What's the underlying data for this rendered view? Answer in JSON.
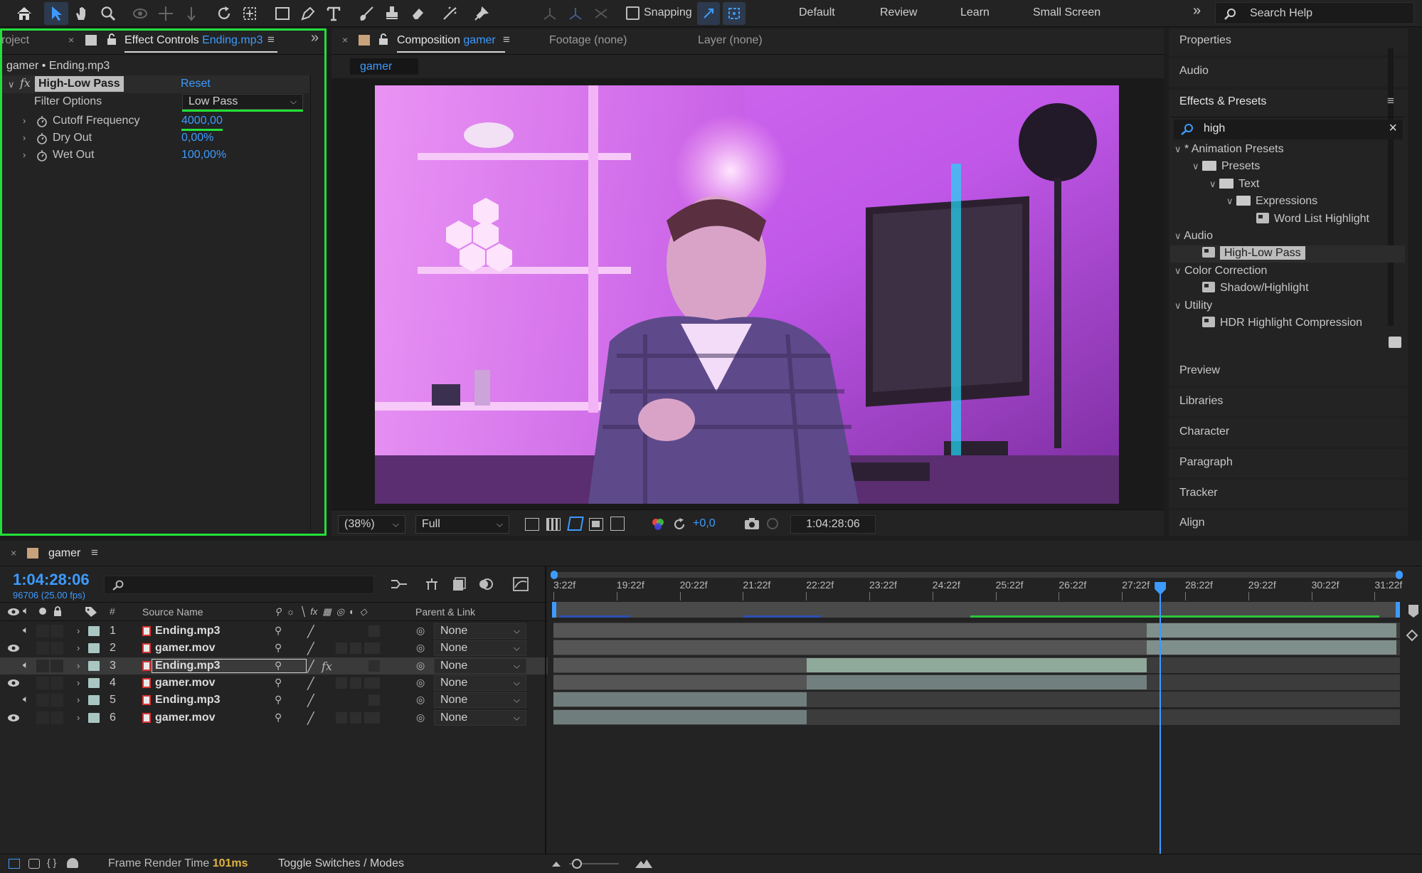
{
  "toolbar": {
    "snapping_label": "Snapping",
    "workspaces": [
      "Default",
      "Review",
      "Learn",
      "Small Screen"
    ],
    "search_placeholder": "Search Help",
    "tool_icons": [
      "home-icon",
      "selection-tool-icon",
      "hand-tool-icon",
      "zoom-tool-icon",
      "orbit-camera-icon",
      "pan-camera-icon",
      "dolly-camera-icon",
      "rotation-tool-icon",
      "pan-behind-icon",
      "rectangle-tool-icon",
      "pen-tool-icon",
      "type-tool-icon",
      "brush-tool-icon",
      "clone-stamp-icon",
      "eraser-tool-icon",
      "roto-brush-icon",
      "puppet-pin-icon"
    ]
  },
  "effect_controls": {
    "tab_project": "roject",
    "tab_label": "Effect Controls",
    "tab_file": "Ending.mp3",
    "breadcrumb": "gamer • Ending.mp3",
    "effect_name": "High-Low Pass",
    "reset_label": "Reset",
    "filter_options_label": "Filter Options",
    "filter_options_value": "Low Pass",
    "params": [
      {
        "label": "Cutoff Frequency",
        "value": "4000,00"
      },
      {
        "label": "Dry Out",
        "value": "0,00%"
      },
      {
        "label": "Wet Out",
        "value": "100,00%"
      }
    ]
  },
  "composition": {
    "tab_label": "Composition",
    "tab_name": "gamer",
    "footage_tab": "Footage (none)",
    "layer_tab": "Layer (none)",
    "subtab": "gamer",
    "zoom": "(38%)",
    "resolution": "Full",
    "exposure": "+0,0",
    "timecode": "1:04:28:06"
  },
  "right_panel": {
    "properties": "Properties",
    "audio": "Audio",
    "effects_presets": "Effects & Presets",
    "search_value": "high",
    "tree": [
      {
        "label": "* Animation Presets",
        "level": 0,
        "kind": "category"
      },
      {
        "label": "Presets",
        "level": 1,
        "kind": "folder"
      },
      {
        "label": "Text",
        "level": 2,
        "kind": "folder"
      },
      {
        "label": "Expressions",
        "level": 3,
        "kind": "folder"
      },
      {
        "label": "Word List Highlight",
        "level": 4,
        "kind": "preset"
      },
      {
        "label": "Audio",
        "level": 0,
        "kind": "category"
      },
      {
        "label": "High-Low Pass",
        "level": 1,
        "kind": "effect",
        "selected": true
      },
      {
        "label": "Color Correction",
        "level": 0,
        "kind": "category"
      },
      {
        "label": "Shadow/Highlight",
        "level": 1,
        "kind": "effect"
      },
      {
        "label": "Utility",
        "level": 0,
        "kind": "category"
      },
      {
        "label": "HDR Highlight Compression",
        "level": 1,
        "kind": "effect"
      }
    ],
    "collapsed_panels": [
      "Preview",
      "Libraries",
      "Character",
      "Paragraph",
      "Tracker",
      "Align"
    ]
  },
  "timeline": {
    "tab_name": "gamer",
    "current_time": "1:04:28:06",
    "frame_info": "96706 (25.00 fps)",
    "col_number": "#",
    "col_source": "Source Name",
    "col_parent": "Parent & Link",
    "ruler_labels": [
      "3:22f",
      "19:22f",
      "20:22f",
      "21:22f",
      "22:22f",
      "23:22f",
      "24:22f",
      "25:22f",
      "26:22f",
      "27:22f",
      "28:22f",
      "29:22f",
      "30:22f",
      "31:22f"
    ],
    "playhead_label_index": 9,
    "layers": [
      {
        "num": "1",
        "name": "Ending.mp3",
        "type": "audio",
        "parent": "None",
        "fx": false,
        "selected": false
      },
      {
        "num": "2",
        "name": "gamer.mov",
        "type": "video",
        "parent": "None",
        "fx": false,
        "selected": false
      },
      {
        "num": "3",
        "name": "Ending.mp3",
        "type": "audio",
        "parent": "None",
        "fx": true,
        "selected": true
      },
      {
        "num": "4",
        "name": "gamer.mov",
        "type": "video",
        "parent": "None",
        "fx": false,
        "selected": false
      },
      {
        "num": "5",
        "name": "Ending.mp3",
        "type": "audio",
        "parent": "None",
        "fx": false,
        "selected": false
      },
      {
        "num": "6",
        "name": "gamer.mov",
        "type": "video",
        "parent": "None",
        "fx": false,
        "selected": false
      }
    ]
  },
  "status_bar": {
    "render_label": "Frame Render Time",
    "render_value": "101ms",
    "toggle_label": "Toggle Switches / Modes"
  },
  "colors": {
    "accent_blue": "#3d9bff",
    "highlight_green": "#22e03a",
    "layer_swatch": "#a9c6c2",
    "selected_row": "#3a3a3a"
  }
}
